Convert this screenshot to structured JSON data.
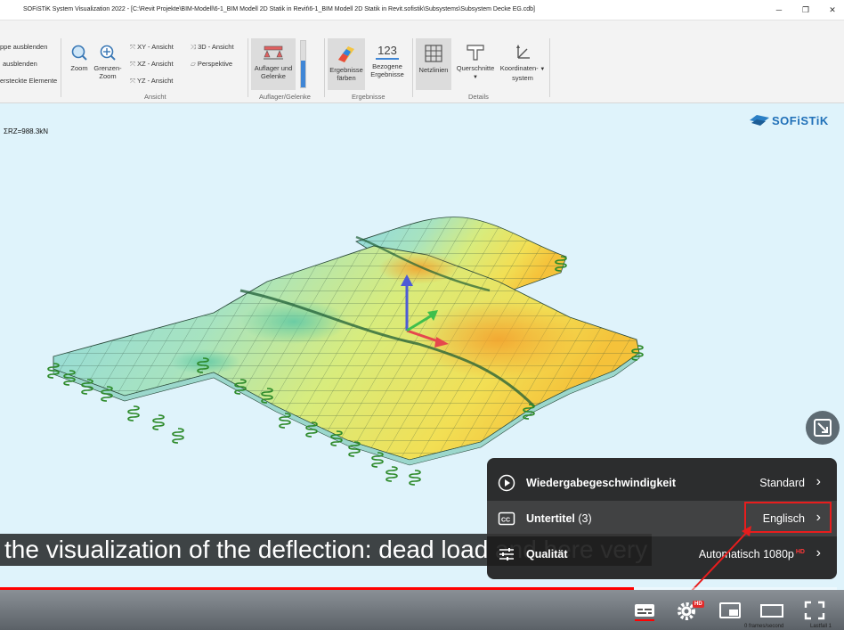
{
  "window": {
    "title": "SOFiSTiK System Visualization 2022 - [C:\\Revit Projekte\\BIM-Modell\\6-1_BIM Modell 2D Statik in Revit\\6-1_BIM Modell 2D Statik in Revit.sofistik\\Subsystems\\Subsystem Decke EG.cdb]"
  },
  "ribbon": {
    "visibility": {
      "items": [
        "ppe ausblenden",
        "ausblenden",
        "ersteckte Elemente"
      ]
    },
    "ansicht": {
      "label": "Ansicht",
      "zoom": "Zoom",
      "grenzen_zoom": [
        "Grenzen-",
        "Zoom"
      ],
      "views": [
        "XY - Ansicht",
        "XZ - Ansicht",
        "YZ - Ansicht"
      ],
      "view3d": "3D - Ansicht",
      "perspektive": "Perspektive"
    },
    "auflager": {
      "label": "Auflager/Gelenke",
      "button": [
        "Auflager und",
        "Gelenke"
      ]
    },
    "ergebnisse": {
      "label": "Ergebnisse",
      "faerben": [
        "Ergebnisse",
        "färben"
      ],
      "bezogene": [
        "Bezogene",
        "Ergebnisse"
      ],
      "bezogene_icon_text": "123"
    },
    "details": {
      "label": "Details",
      "netzlinien": "Netzlinien",
      "querschnitte": "Querschnitte",
      "koordinaten": [
        "Koordinaten-",
        "system"
      ]
    }
  },
  "viewport": {
    "sum_label": "ΣRZ=988.3kN",
    "logo": "SOFiSTiK"
  },
  "caption": {
    "text": "the visualization of the deflection: dead load and here very"
  },
  "settings_menu": {
    "rows": [
      {
        "label": "Wiedergabegeschwindigkeit",
        "value": "Standard",
        "icon": "playback-speed-icon"
      },
      {
        "label": "Untertitel",
        "count": "(3)",
        "value": "Englisch",
        "icon": "subtitles-icon"
      },
      {
        "label": "Qualität",
        "value": "Automatisch",
        "value_extra": "1080p",
        "value_badge": "HD",
        "icon": "quality-sliders-icon"
      }
    ]
  },
  "player": {
    "progress_fraction": 0.757,
    "hd_badge": "HD",
    "status_left": "0 frames/second",
    "status_right": "Lastfall 1"
  },
  "colors": {
    "highlight": "#e81d1d",
    "progress": "#ff0000"
  }
}
